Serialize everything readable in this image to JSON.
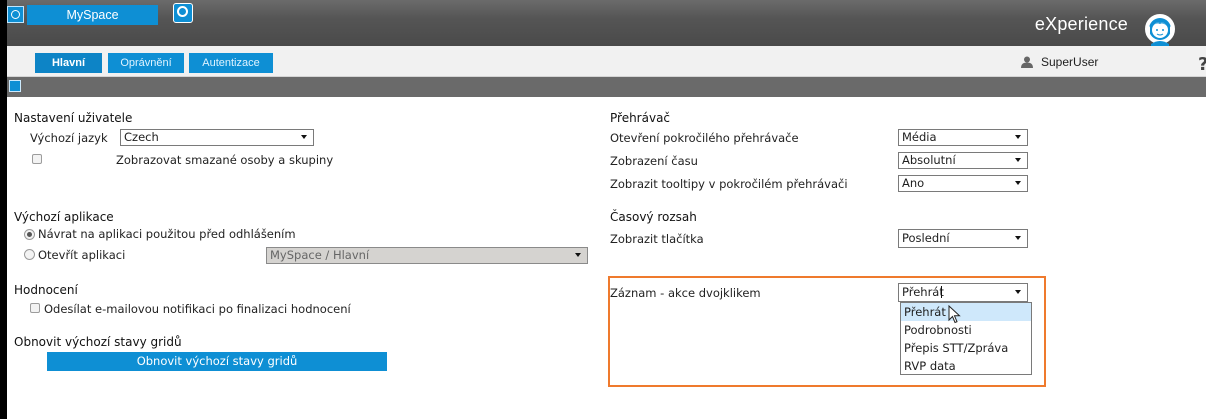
{
  "header": {
    "app_name": "MySpace",
    "brand": "eXperience",
    "tabs": [
      {
        "label": "Hlavní",
        "active": true
      },
      {
        "label": "Oprávnění",
        "active": false
      },
      {
        "label": "Autentizace",
        "active": false
      }
    ],
    "user_name": "SuperUser",
    "help_glyph": "?"
  },
  "user_settings": {
    "title": "Nastavení uživatele",
    "language_label": "Výchozí jazyk",
    "language_value": "Czech",
    "show_deleted_label": "Zobrazovat smazané osoby a skupiny"
  },
  "default_app": {
    "title": "Výchozí aplikace",
    "return_label": "Návrat na aplikaci použitou před odhlášením",
    "open_label": "Otevřít aplikaci",
    "open_value": "MySpace / Hlavní"
  },
  "rating": {
    "title": "Hodnocení",
    "email_label": "Odesílat e-mailovou notifikaci po finalizaci hodnocení"
  },
  "grid_reset": {
    "title": "Obnovit výchozí stavy gridů",
    "button_label": "Obnovit výchozí stavy gridů"
  },
  "player": {
    "title": "Přehrávač",
    "advanced_label": "Otevření pokročilého přehrávače",
    "advanced_value": "Média",
    "time_label": "Zobrazení času",
    "time_value": "Absolutní",
    "tooltips_label": "Zobrazit tooltipy v pokročilém přehrávači",
    "tooltips_value": "Ano"
  },
  "time_range": {
    "title": "Časový rozsah",
    "buttons_label": "Zobrazit tlačítka",
    "buttons_value": "Poslední"
  },
  "record": {
    "dblclick_label": "Záznam - akce dvojklikem",
    "dblclick_value": "Přehrát",
    "options": [
      "Přehrát",
      "Podrobnosti",
      "Přepis STT/Zpráva",
      "RVP data"
    ],
    "hovered_option": 0
  },
  "colors": {
    "accent": "#0e8fd4",
    "highlight": "#ef7a2d",
    "header": "#555555"
  },
  "icons": {
    "app": "app-icon",
    "switch": "app-switch-icon",
    "avatar": "support-avatar-icon",
    "user": "user-icon",
    "save": "save-icon"
  }
}
